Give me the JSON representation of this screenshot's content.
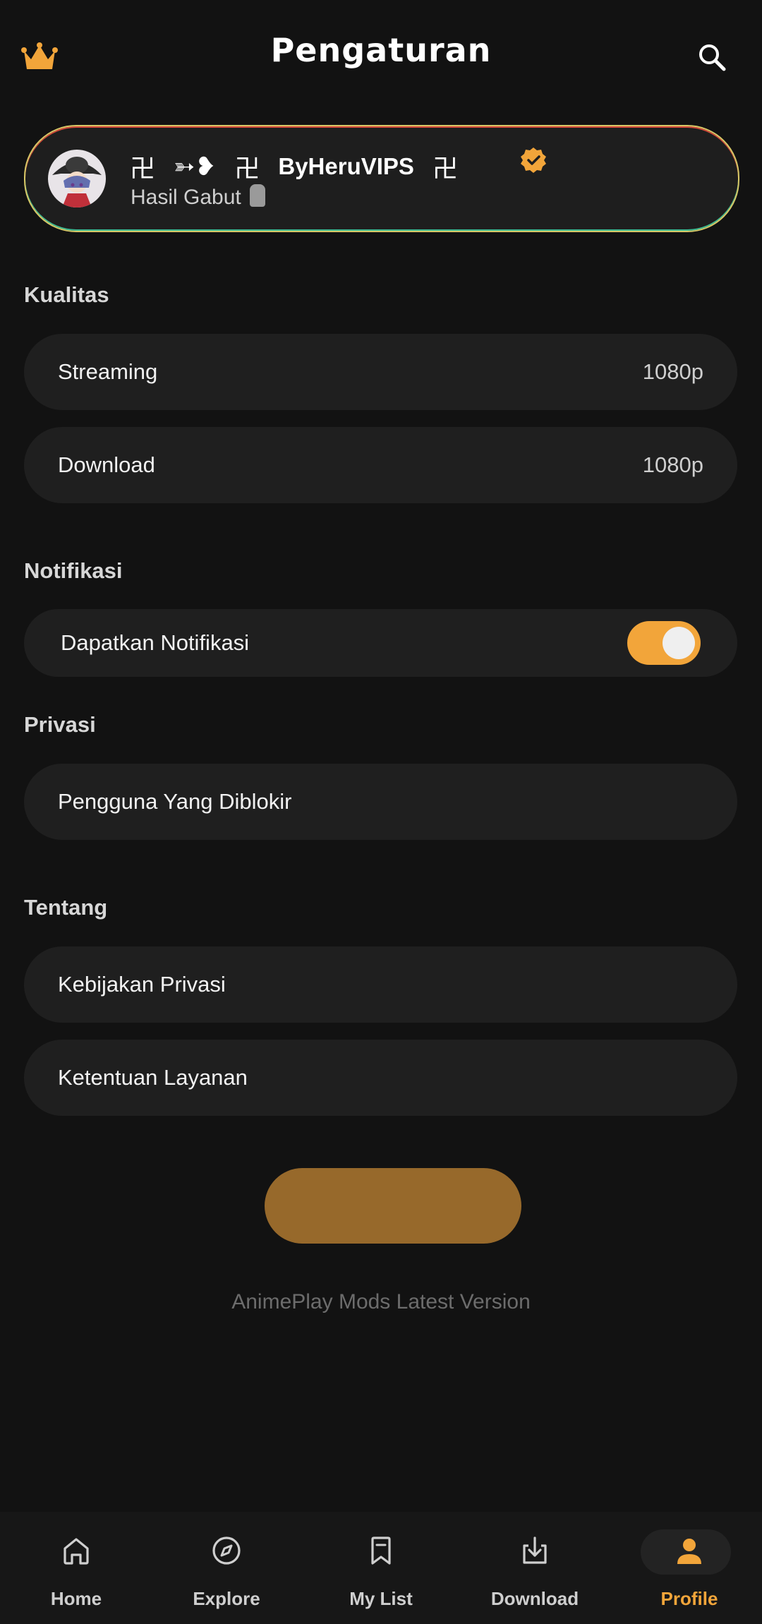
{
  "header": {
    "title": "Pengaturan",
    "left_icon": "crown-icon",
    "right_icon": "search-icon"
  },
  "profile": {
    "symbol_left": "卍",
    "arrow_heart": "➳❥",
    "symbol_mid": "卍",
    "username": "ByHeruVIPS",
    "symbol_right": "卍",
    "verified_icon": "verified-badge-icon",
    "status": "Hasil Gabut",
    "status_emoji_icon": "moai-icon"
  },
  "sections": {
    "quality": "Kualitas",
    "notifications": "Notifikasi",
    "privacy": "Privasi",
    "about": "Tentang"
  },
  "quality": {
    "streaming_label": "Streaming",
    "streaming_value": "1080p",
    "download_label": "Download",
    "download_value": "1080p"
  },
  "notifications": {
    "get_label": "Dapatkan Notifikasi",
    "enabled": true
  },
  "privacy": {
    "blocked_label": "Pengguna Yang Diblokir"
  },
  "about": {
    "privacy_policy_label": "Kebijakan Privasi",
    "terms_label": "Ketentuan Layanan"
  },
  "footer": {
    "version_text": "AnimePlay Mods Latest Version"
  },
  "bottom_nav": {
    "items": [
      {
        "label": "Home",
        "icon": "home-icon"
      },
      {
        "label": "Explore",
        "icon": "compass-icon"
      },
      {
        "label": "My List",
        "icon": "bookmark-icon"
      },
      {
        "label": "Download",
        "icon": "download-icon"
      },
      {
        "label": "Profile",
        "icon": "person-icon"
      }
    ],
    "active_index": 4
  },
  "colors": {
    "accent": "#f2a53a",
    "background": "#121212",
    "surface": "#1f1f1f",
    "button": "#97692b"
  }
}
